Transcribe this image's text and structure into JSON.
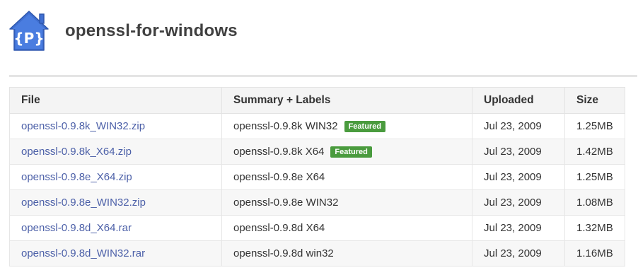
{
  "project": {
    "title": "openssl-for-windows",
    "logo_icon": "project-house-icon",
    "logo_text": "{P}"
  },
  "colors": {
    "logo_blue": "#3f6fd1",
    "badge_green": "#4a9b3e",
    "link": "#4c60a8"
  },
  "table": {
    "headers": {
      "file": "File",
      "summary": "Summary + Labels",
      "uploaded": "Uploaded",
      "size": "Size"
    },
    "rows": [
      {
        "file": "openssl-0.9.8k_WIN32.zip",
        "summary": "openssl-0.9.8k WIN32",
        "label": "Featured",
        "uploaded": "Jul 23, 2009",
        "size": "1.25MB"
      },
      {
        "file": "openssl-0.9.8k_X64.zip",
        "summary": "openssl-0.9.8k X64",
        "label": "Featured",
        "uploaded": "Jul 23, 2009",
        "size": "1.42MB"
      },
      {
        "file": "openssl-0.9.8e_X64.zip",
        "summary": "openssl-0.9.8e X64",
        "label": "",
        "uploaded": "Jul 23, 2009",
        "size": "1.25MB"
      },
      {
        "file": "openssl-0.9.8e_WIN32.zip",
        "summary": "openssl-0.9.8e WIN32",
        "label": "",
        "uploaded": "Jul 23, 2009",
        "size": "1.08MB"
      },
      {
        "file": "openssl-0.9.8d_X64.rar",
        "summary": "openssl-0.9.8d X64",
        "label": "",
        "uploaded": "Jul 23, 2009",
        "size": "1.32MB"
      },
      {
        "file": "openssl-0.9.8d_WIN32.rar",
        "summary": "openssl-0.9.8d win32",
        "label": "",
        "uploaded": "Jul 23, 2009",
        "size": "1.16MB"
      }
    ]
  }
}
